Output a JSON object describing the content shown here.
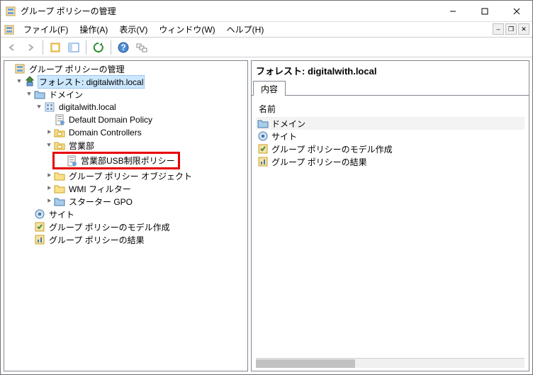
{
  "window": {
    "title": "グループ ポリシーの管理"
  },
  "menu": {
    "file": "ファイル(F)",
    "action": "操作(A)",
    "view": "表示(V)",
    "window": "ウィンドウ(W)",
    "help": "ヘルプ(H)"
  },
  "tree": {
    "root": "グループ ポリシーの管理",
    "forest": "フォレスト: digitalwith.local",
    "domains": "ドメイン",
    "domain": "digitalwith.local",
    "default_policy": "Default Domain Policy",
    "domain_controllers": "Domain Controllers",
    "sales_ou": "営業部",
    "sales_usb_policy": "営業部USB制限ポリシー",
    "gpo_objects": "グループ ポリシー オブジェクト",
    "wmi_filters": "WMI フィルター",
    "starter_gpo": "スターター GPO",
    "sites": "サイト",
    "gp_modeling": "グループ ポリシーのモデル作成",
    "gp_results": "グループ ポリシーの結果"
  },
  "right": {
    "header": "フォレスト: digitalwith.local",
    "tab": "内容",
    "col_name": "名前",
    "rows": {
      "domains": "ドメイン",
      "sites": "サイト",
      "gp_modeling": "グループ ポリシーのモデル作成",
      "gp_results": "グループ ポリシーの結果"
    }
  }
}
